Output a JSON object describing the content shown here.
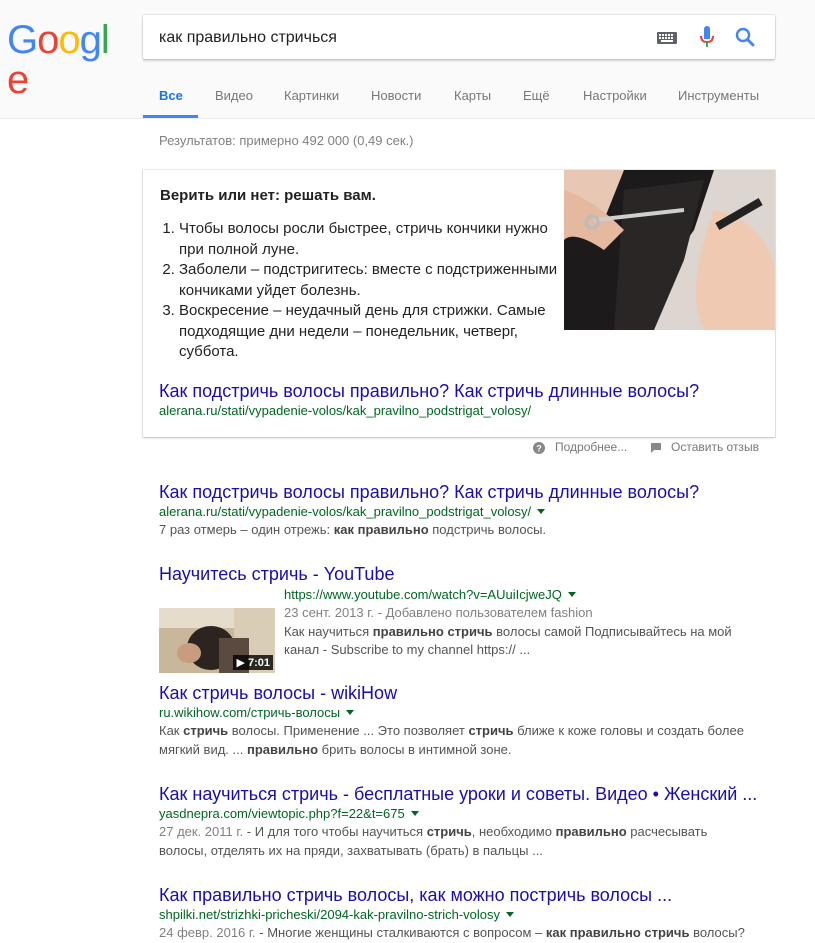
{
  "search": {
    "query": "как правильно стричься"
  },
  "tabs": [
    {
      "label": "Все",
      "active": true
    },
    {
      "label": "Видео"
    },
    {
      "label": "Картинки"
    },
    {
      "label": "Новости"
    },
    {
      "label": "Карты"
    },
    {
      "label": "Ещё"
    },
    {
      "label": "Настройки"
    },
    {
      "label": "Инструменты"
    }
  ],
  "stats": "Результатов: примерно 492 000 (0,49 сек.)",
  "snippet": {
    "title": "Верить или нет: решать вам.",
    "items": [
      "Чтобы волосы росли быстрее, стричь кончики нужно при полной луне.",
      "Заболели – подстригитесь: вместе с подстриженными кончиками уйдет болезнь.",
      "Воскресение – неудачный день для стрижки. Самые подходящие дни недели – понедельник, четверг, суббота."
    ],
    "link": "Как подстричь волосы правильно? Как стричь длинные волосы?",
    "url": "alerana.ru/stati/vypadenie-volos/kak_pravilno_podstrigat_volosy/"
  },
  "feedback": {
    "more": "Подробнее...",
    "review": "Оставить отзыв"
  },
  "results": [
    {
      "title": "Как подстричь волосы правильно? Как стричь длинные волосы?",
      "url": "alerana.ru/stati/vypadenie-volos/kak_pravilno_podstrigat_volosy/",
      "desc_pre": "7 раз отмерь – один отрежь: ",
      "desc_b1": "как правильно",
      "desc_post": " подстричь волосы."
    },
    {
      "title": "Научитесь стричь - YouTube",
      "url": "https://www.youtube.com/watch?v=AUuiIcjweJQ",
      "meta": "23 сент. 2013 г. - Добавлено пользователем fashion",
      "desc_pre": "Как научиться ",
      "desc_b1": "правильно стричь",
      "desc_post": " волосы самой Подписывайтесь на мой канал - Subscribe to my channel https:// ...",
      "duration": "▶ 7:01"
    },
    {
      "title": "Как стричь волосы - wikiHow",
      "url": "ru.wikihow.com/стричь-волосы",
      "d1": "Как ",
      "d2": "стричь",
      "d3": " волосы. Применение ... Это позволяет ",
      "d4": "стричь",
      "d5": " ближе к коже головы и создать более мягкий вид. ... ",
      "d6": "правильно",
      "d7": " брить волосы в интимной зоне."
    },
    {
      "title": "Как научиться стричь - бесплатные уроки и советы. Видео • Женский ...",
      "url": "yasdnepra.com/viewtopic.php?f=22&t=675",
      "date": "27 дек. 2011 г.",
      "d1": " - И для того чтобы научиться ",
      "d2": "стричь",
      "d3": ", необходимо ",
      "d4": "правильно",
      "d5": " расчесывать волосы, отделять их на пряди, захватывать (брать) в пальцы ..."
    },
    {
      "title": "Как правильно стричь волосы, как можно постричь волосы ...",
      "url": "shpilki.net/strizhki-pricheski/2094-kak-pravilno-strich-volosy",
      "date": "24 февр. 2016 г.",
      "d1": " - Многие женщины сталкиваются с вопросом – ",
      "d2": "как правильно стричь",
      "d3": " волосы?"
    }
  ],
  "colors": {
    "link": "#1a0dab",
    "url": "#006621",
    "tab_active": "#1a73e8"
  }
}
